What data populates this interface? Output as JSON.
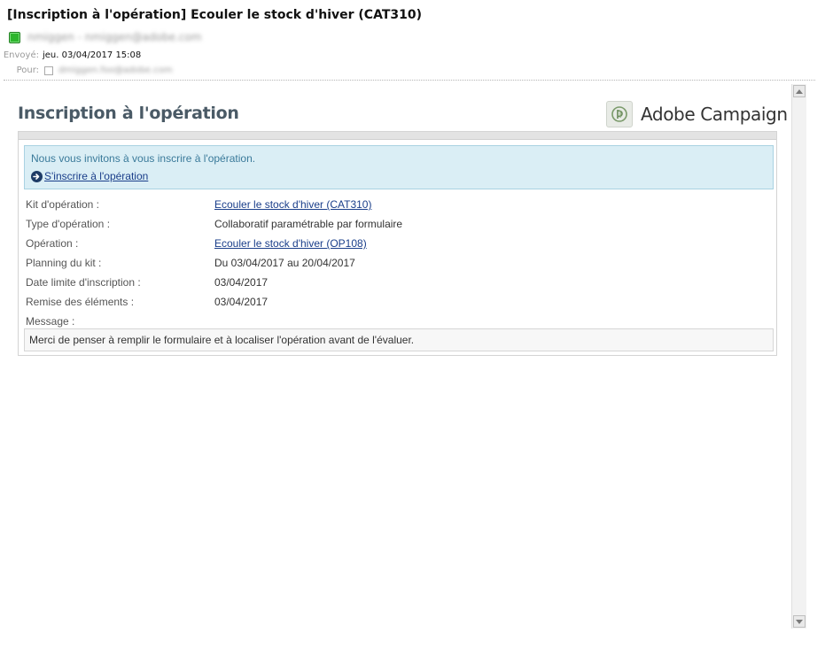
{
  "email": {
    "subject": "[Inscription à l'opération] Ecouler le stock d'hiver  (CAT310)",
    "sender_blurred": "nmiggen - nmiggen@adobe.com",
    "sent_label": "Envoyé:",
    "sent_value": "jeu. 03/04/2017 15:08",
    "to_label": "Pour:",
    "to_blurred": "dmiggen.foo@adobe.com"
  },
  "brand": {
    "name": "Adobe Campaign",
    "logo_icon": "adobe-campaign-logo-icon"
  },
  "body": {
    "heading": "Inscription à l'opération",
    "invite_text": "Nous vous invitons à vous inscrire à l'opération.",
    "invite_link": "S'inscrire à l'opération",
    "fields": [
      {
        "label": "Kit d'opération :",
        "value": "Ecouler le stock d'hiver (CAT310)",
        "link": true
      },
      {
        "label": "Type d'opération :",
        "value": "Collaboratif paramétrable par formulaire",
        "link": false
      },
      {
        "label": "Opération :",
        "value": "Ecouler le stock d'hiver (OP108)",
        "link": true
      },
      {
        "label": "Planning du kit :",
        "value": "Du 03/04/2017 au 20/04/2017",
        "link": false
      },
      {
        "label": "Date limite d'inscription :",
        "value": "03/04/2017",
        "link": false
      },
      {
        "label": "Remise des éléments :",
        "value": "03/04/2017",
        "link": false
      },
      {
        "label": "Message :",
        "value": "",
        "link": false
      }
    ],
    "message": "Merci de penser à remplir le formulaire et à localiser l'opération avant de l'évaluer."
  },
  "colors": {
    "heading": "#4a5a66",
    "link": "#1a3e8a",
    "invite_bg": "#daeef5",
    "presence": "#2db52d"
  }
}
